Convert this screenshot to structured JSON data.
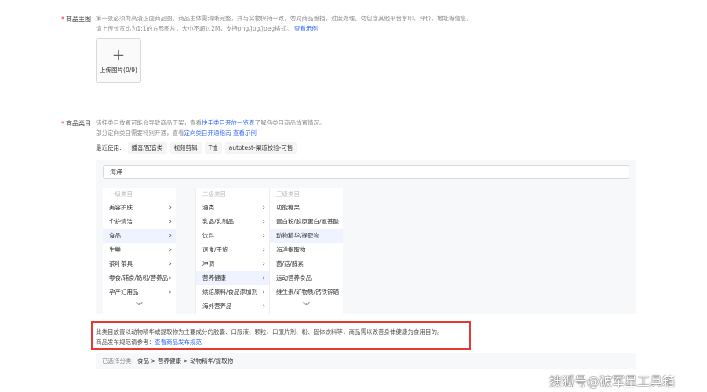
{
  "main_image": {
    "required_mark": "*",
    "label": "商品主图",
    "hint_line1": "第一张必须为高清正面商品图。商品主体需清晰完整，并与实物保持一致，勿对商品遮挡，过度处理。勿包含其他平台水印，评价，地址等信息。",
    "hint_line2": "请上传长宽比为1:1的方形图片，大小不超过2M，支持png/jpg/jpeg格式。",
    "example_link": "查看示例",
    "upload_icon": "plus-icon",
    "upload_plus": "+",
    "upload_label": "上传图片(0/9)"
  },
  "category": {
    "required_mark": "*",
    "label": "商品类目",
    "hint1_prefix": "错挂类目放置可能会导致商品下架，查看",
    "hint1_link": "快手类目开放一览表",
    "hint1_suffix": "了解各类目商品放置情况。",
    "hint2_prefix": "部分定向类目需要特别开通，查看",
    "hint2_link": "定向类目开通指南",
    "hint2_space": " ",
    "hint2_link2": "查看示例",
    "recent_label": "最近使用:",
    "recent_tags": [
      "播音/配音类",
      "视频剪辑",
      "T恤",
      "autotest-渠道校验-可售"
    ]
  },
  "picker": {
    "search_value": "海洋",
    "col1": {
      "header": "一级类目",
      "items": [
        "美容护肤",
        "个护清洁",
        "食品",
        "生鲜",
        "茶叶茶具",
        "零食/辅食/奶粉/营养品",
        "孕产妇用品"
      ],
      "active_index": 2
    },
    "col2": {
      "header": "二级类目",
      "items": [
        "酒类",
        "乳品/乳制品",
        "饮料",
        "速食/干货",
        "冲调",
        "营养健康",
        "烘焙原料/食品添加剂",
        "海外营养品"
      ],
      "active_index": 5
    },
    "col3": {
      "header": "三级类目",
      "items": [
        "功能糖果",
        "蛋白粉/胶原蛋白/氨基酸",
        "动物精华/提取物",
        "海洋提取物",
        "菌/菇/酵素",
        "运动营养食品",
        "维生素/矿物质/钙铁锌硒"
      ],
      "active_index": 2
    },
    "chevron_icon": "chevron-right-icon",
    "chevron_glyph": "›",
    "more_icon": "double-chevron-down-icon",
    "more_glyph": "︾"
  },
  "description": {
    "line1": "此类目放置以动物精华或提取物为主要成分的胶囊、口服液、颗粒、口服片剂、粉、固体饮料等，商品需以改善身体健康为食用目的。",
    "line2_prefix": "商品发布规范请参考：",
    "line2_link": "查看商品发布规范",
    "highlight_color": "#e53935"
  },
  "selected": {
    "label": "已选择分类：",
    "path": "食品 > 营养健康 > 动物精华/提取物"
  },
  "watermark": "搜狐号@破军星工具箱",
  "colors": {
    "link": "#326bfb",
    "required": "#f5222d",
    "active_bg": "#eef3ff"
  }
}
